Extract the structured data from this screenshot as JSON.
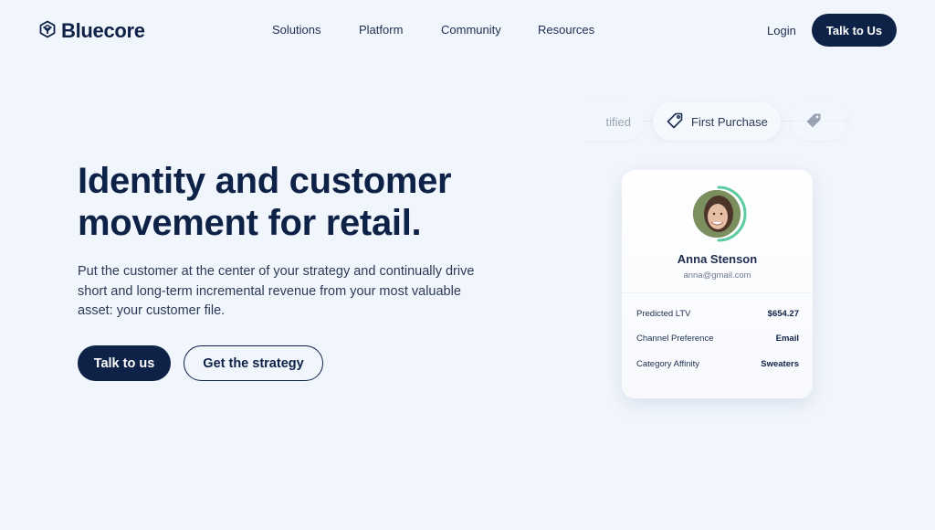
{
  "header": {
    "brand": "Bluecore",
    "nav": [
      "Solutions",
      "Platform",
      "Community",
      "Resources"
    ],
    "login_label": "Login",
    "cta_label": "Talk to Us"
  },
  "hero": {
    "headline_line1": "Identity and customer",
    "headline_line2": "movement for retail.",
    "subtext": "Put the customer at the center of your strategy and continually drive short and long-term incremental revenue from your most valuable asset: your customer file.",
    "primary_button": "Talk to us",
    "secondary_button": "Get the strategy"
  },
  "tags": {
    "left_partial": "tified",
    "active": "First Purchase"
  },
  "profile_card": {
    "name": "Anna Stenson",
    "email": "anna@gmail.com",
    "progress_ring_fraction": 0.5,
    "rows": [
      {
        "label": "Predicted LTV",
        "value": "$654.27"
      },
      {
        "label": "Channel Preference",
        "value": "Email"
      },
      {
        "label": "Category Affinity",
        "value": "Sweaters"
      }
    ]
  },
  "colors": {
    "brand_navy": "#0e2247",
    "background": "#f1f6fd",
    "ring_green": "#5ccca0"
  }
}
